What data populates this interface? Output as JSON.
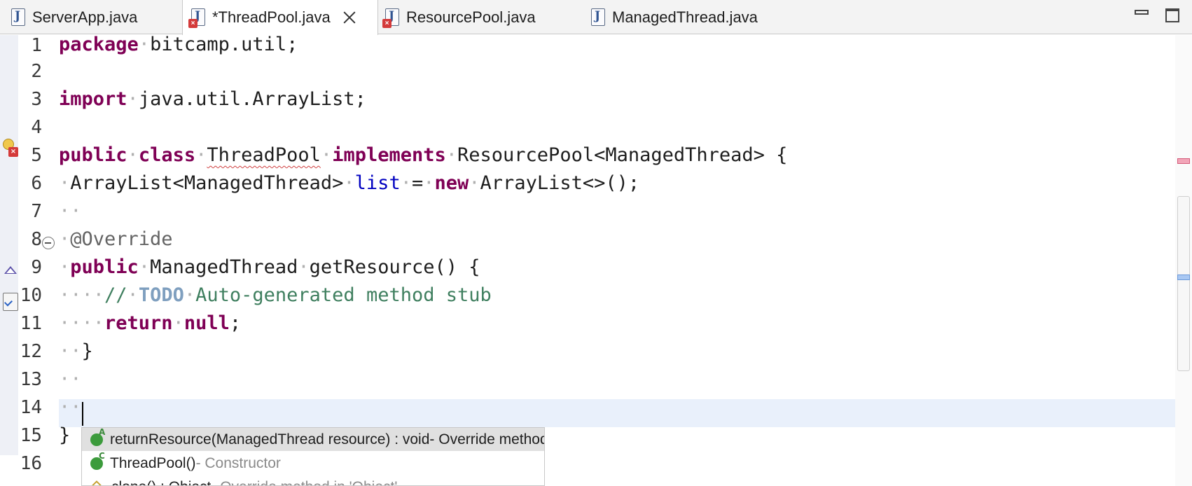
{
  "tabs": [
    {
      "label": "ServerApp.java",
      "error": false,
      "active": false
    },
    {
      "label": "*ThreadPool.java",
      "error": true,
      "active": true
    },
    {
      "label": "ResourcePool.java",
      "error": true,
      "active": false
    },
    {
      "label": "ManagedThread.java",
      "error": false,
      "active": false
    }
  ],
  "line_numbers": [
    "1",
    "2",
    "3",
    "4",
    "5",
    "6",
    "7",
    "8",
    "9",
    "10",
    "11",
    "12",
    "13",
    "14",
    "15",
    "16"
  ],
  "code": {
    "l1_kw": "package",
    "l1_rest": "bitcamp.util;",
    "l3_kw": "import",
    "l3_rest": "java.util.ArrayList;",
    "l5_kw1": "public",
    "l5_kw2": "class",
    "l5_class": "ThreadPool",
    "l5_kw3": "implements",
    "l5_rest": "ResourcePool<ManagedThread> {",
    "l6_type": "ArrayList<ManagedThread>",
    "l6_field": "list",
    "l6_eq": "=",
    "l6_kw": "new",
    "l6_rest": "ArrayList<>();",
    "l8_ann": "@Override",
    "l9_kw": "public",
    "l9_type": "ManagedThread",
    "l9_rest": "getResource() {",
    "l10_cm1": "//",
    "l10_todo": "TODO",
    "l10_cm2": "Auto-generated method stub",
    "l11_kw1": "return",
    "l11_kw2": "null",
    "l11_semi": ";",
    "l12_brace": "}",
    "l15_brace": "}"
  },
  "completion": {
    "items": [
      {
        "name": "returnResource(ManagedThread resource) : void",
        "desc": " - Override method in 'ResourcePool'",
        "badge": "A"
      },
      {
        "name": "ThreadPool()",
        "desc": " - Constructor",
        "badge": "C"
      },
      {
        "name": "clone() : Object",
        "desc": " - Override method in 'Object'",
        "badge": ""
      }
    ]
  },
  "colors": {
    "keyword": "#7f0055",
    "field": "#0000c0",
    "comment": "#3f7f5f",
    "todo": "#7f9fbf",
    "current_line": "#e9f0fb"
  }
}
